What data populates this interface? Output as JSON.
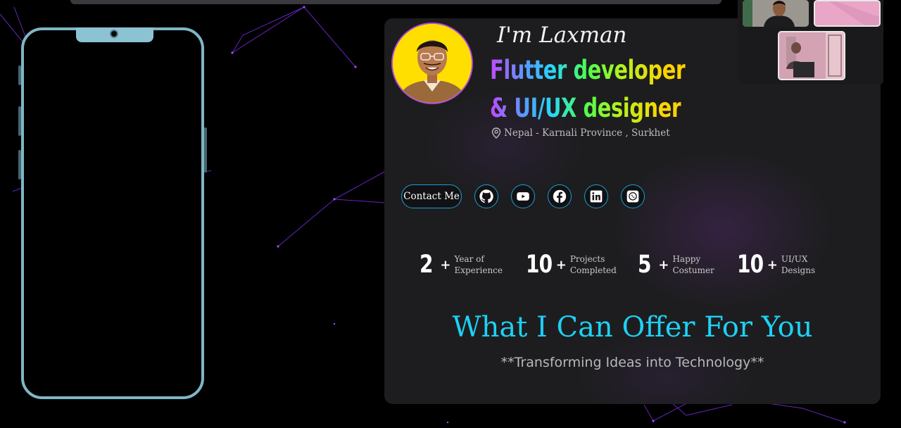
{
  "profile": {
    "intro": "I'm Laxman",
    "role_line1": "Flutter developer",
    "role_line2": "& UI/UX designer",
    "location": "Nepal - Karnali Province ,  Surkhet"
  },
  "actions": {
    "contact_label": "Contact Me",
    "social_icons": [
      "github-icon",
      "youtube-icon",
      "facebook-icon",
      "linkedin-icon",
      "whatsapp-icon"
    ]
  },
  "stats": [
    {
      "number": "2",
      "plus": "+",
      "line1": "Year of",
      "line2": "Experience"
    },
    {
      "number": "10",
      "plus": "+",
      "line1": "Projects",
      "line2": "Completed"
    },
    {
      "number": "5",
      "plus": "+",
      "line1": "Happy",
      "line2": "Costumer"
    },
    {
      "number": "10",
      "plus": "+",
      "line1": "UI/UX",
      "line2": "Designs"
    }
  ],
  "offer": {
    "heading": "What I Can Offer For You",
    "tagline": "**Transforming Ideas into Technology**"
  },
  "colors": {
    "accent_cyan": "#1ed0f5",
    "button_border": "#1a9fd6",
    "phone_frame": "#7fb6c6",
    "card_bg": "#1d1d1f",
    "network_lines": "#7a2be0"
  }
}
